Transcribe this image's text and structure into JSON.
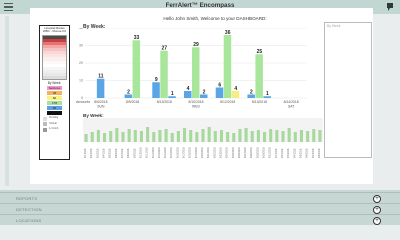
{
  "app": {
    "title": "FerrAlert™ Encompass"
  },
  "welcome": "Hello John Smith, Welcome to your DASHBOARD:",
  "legend": {
    "header": "Hospital Ranks\nWBC - Mouse ICI",
    "by_week_label": "By Week:",
    "heat_colors": [
      "#4a4a4a",
      "#c83d3d",
      "#e77272",
      "#f4a6a6",
      "#f7c2c2",
      "#f8d7d7",
      "#fae3e3",
      "#fcefef",
      "#fef8f8",
      "#ffffff",
      "#f6f6f6",
      "#efefef",
      "#e8e8e8",
      "#dcdcdc"
    ],
    "rows": [
      {
        "text": "Seizures",
        "color": "#f09bd0"
      },
      {
        "text": "45",
        "color": "#f5b25a"
      },
      {
        "text": "82",
        "color": "#f7f28a"
      },
      {
        "text": "178",
        "color": "#a6e29c"
      },
      {
        "text": "52",
        "color": "#5c9fe6"
      },
      {
        "text": "",
        "color": "#111111"
      }
    ],
    "notes": [
      "Pending",
      "Critical",
      "1-3 Amb"
    ]
  },
  "side_panel": {
    "label": "By Week"
  },
  "chart_data": {
    "type": "bar",
    "title": "By Week:",
    "ylim": [
      0,
      40
    ],
    "yticks": [
      0,
      10,
      20,
      30,
      40
    ],
    "x_header": "Amounts",
    "dates": [
      "8/6/2018",
      "8/9/2018",
      "8/13/2018",
      "8/10/2018",
      "8/12/2018",
      "8/13/2018",
      "8/14/2018"
    ],
    "days": [
      "SUN",
      "",
      "",
      "WED",
      "",
      "",
      "SAT"
    ],
    "bars": [
      {
        "category": 0,
        "value": 11,
        "color": "#5aa5e6"
      },
      {
        "category": 1,
        "value": 2,
        "color": "#5aa5e6"
      },
      {
        "category": 1,
        "value": 33,
        "color": "#a8e69c"
      },
      {
        "category": 2,
        "value": 9,
        "color": "#5aa5e6"
      },
      {
        "category": 2,
        "value": 27,
        "color": "#a8e69c"
      },
      {
        "category": 2,
        "value": 1,
        "color": "#5aa5e6"
      },
      {
        "category": 3,
        "value": 4,
        "color": "#5aa5e6"
      },
      {
        "category": 3,
        "value": 29,
        "color": "#a8e69c"
      },
      {
        "category": 3,
        "value": 2,
        "color": "#5aa5e6"
      },
      {
        "category": 4,
        "value": 6,
        "color": "#5aa5e6"
      },
      {
        "category": 4,
        "value": 36,
        "color": "#a8e69c"
      },
      {
        "category": 4,
        "value": 4,
        "color": "#f7ee7e"
      },
      {
        "category": 5,
        "value": 2,
        "color": "#5aa5e6"
      },
      {
        "category": 5,
        "value": 25,
        "color": "#a8e69c"
      },
      {
        "category": 5,
        "value": 1,
        "color": "#5aa5e6"
      }
    ]
  },
  "mini_chart": {
    "title": "By Week:",
    "green_values": [
      8,
      10,
      12,
      9,
      11,
      14,
      10,
      13,
      12,
      11,
      15,
      10,
      12,
      13,
      9,
      11,
      14,
      12,
      10,
      13,
      15,
      11,
      12,
      10,
      9,
      13,
      14,
      11,
      12,
      10,
      13,
      12,
      11,
      14,
      10,
      12,
      11,
      13,
      12
    ],
    "date_labels": [
      "8/1/2018",
      "8/2/2018",
      "8/3/2018",
      "8/4/2018",
      "8/5/2018",
      "8/6/2018",
      "8/7/2018",
      "8/8/2018",
      "8/9/2018",
      "8/10/2018",
      "8/11/2018",
      "8/12/2018",
      "8/13/2018",
      "8/14/2018",
      "8/15/2018",
      "8/16/2018",
      "8/17/2018",
      "8/18/2018",
      "8/19/2018",
      "8/20/2018",
      "8/21/2018",
      "8/22/2018",
      "8/23/2018",
      "8/24/2018",
      "8/25/2018",
      "8/26/2018",
      "8/27/2018",
      "8/28/2018",
      "8/29/2018",
      "8/30/2018",
      "8/31/2018",
      "9/1/2018",
      "9/2/2018",
      "9/3/2018",
      "9/4/2018",
      "9/5/2018",
      "9/6/2018",
      "9/7/2018",
      "9/8/2018"
    ]
  },
  "bottom": {
    "rows": [
      {
        "label": "REPORTS"
      },
      {
        "label": "DETECTION"
      },
      {
        "label": "LOCATIONS"
      }
    ],
    "plus": "+"
  }
}
